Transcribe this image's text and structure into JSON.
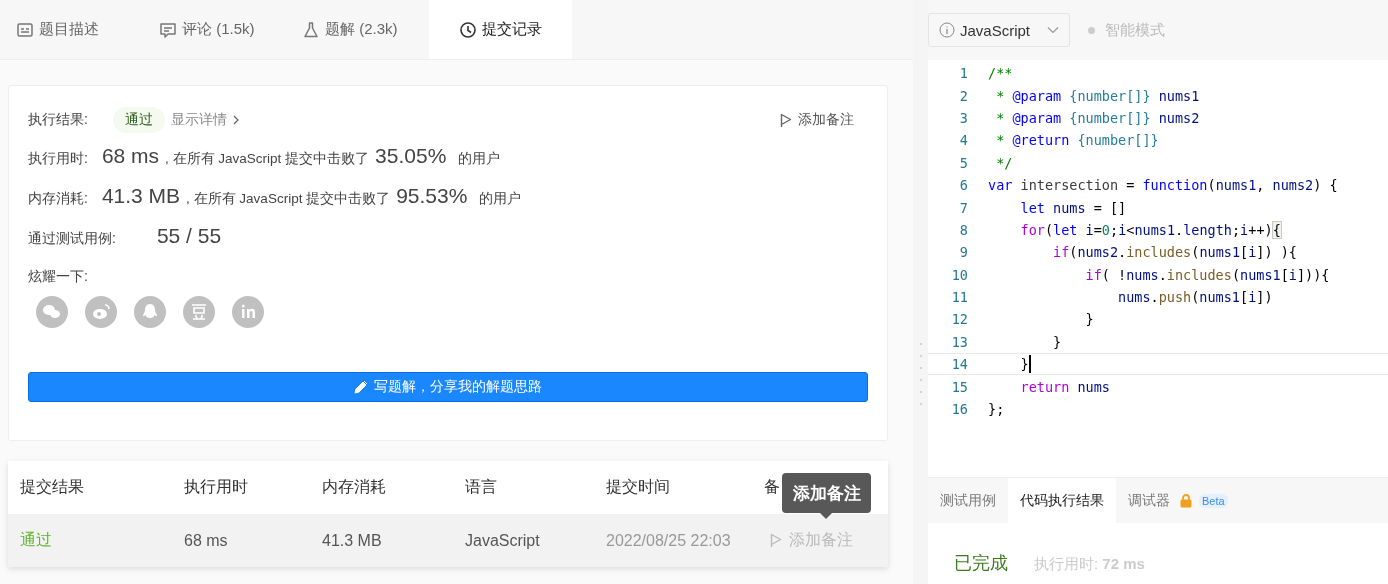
{
  "tabs": [
    {
      "label": "题目描述",
      "selected": false
    },
    {
      "label": "评论 (1.5k)",
      "selected": false
    },
    {
      "label": "题解 (2.3k)",
      "selected": false
    },
    {
      "label": "提交记录",
      "selected": true
    }
  ],
  "result": {
    "status_label": "执行结果:",
    "status": "通过",
    "details_link": "显示详情",
    "note_button": "添加备注",
    "stats": [
      {
        "label": "执行用时:",
        "value": "68 ms",
        "text": ", 在所有 JavaScript 提交中击败了",
        "percent": "35.05%",
        "suffix": "的用户"
      },
      {
        "label": "内存消耗:",
        "value": "41.3 MB",
        "text": ", 在所有 JavaScript 提交中击败了",
        "percent": "95.53%",
        "suffix": "的用户"
      }
    ],
    "tests_label": "通过测试用例:",
    "tests_value": "55 / 55",
    "share_label": "炫耀一下:",
    "share_buttons": [
      {
        "kind": "wechat"
      },
      {
        "kind": "weibo"
      },
      {
        "kind": "qq"
      },
      {
        "kind": "douban"
      },
      {
        "kind": "linkedin"
      }
    ],
    "write_button": "写题解，分享我的解题思路"
  },
  "submissions": {
    "columns": [
      "提交结果",
      "执行用时",
      "内存消耗",
      "语言",
      "提交时间",
      "备"
    ],
    "rows": [
      {
        "status": "通过",
        "runtime": "68 ms",
        "memory": "41.3 MB",
        "language": "JavaScript",
        "time": "2022/08/25 22:03",
        "note": "添加备注",
        "hovered": true
      }
    ],
    "tooltip": "添加备注"
  },
  "editor": {
    "language": "JavaScript",
    "smart_mode": "智能模式",
    "lines": [
      {
        "number": "1",
        "current": false,
        "tokens": [
          {
            "kind": "comment",
            "text": "/**"
          }
        ]
      },
      {
        "number": "2",
        "current": false,
        "tokens": [
          {
            "kind": "comment",
            "text": " * "
          },
          {
            "kind": "tag",
            "text": "@param"
          },
          {
            "kind": "type",
            "text": " {number[]}"
          },
          {
            "kind": "variable",
            "text": " nums1"
          }
        ]
      },
      {
        "number": "3",
        "current": false,
        "tokens": [
          {
            "kind": "comment",
            "text": " * "
          },
          {
            "kind": "tag",
            "text": "@param"
          },
          {
            "kind": "type",
            "text": " {number[]}"
          },
          {
            "kind": "variable",
            "text": " nums2"
          }
        ]
      },
      {
        "number": "4",
        "current": false,
        "tokens": [
          {
            "kind": "comment",
            "text": " * "
          },
          {
            "kind": "tag",
            "text": "@return"
          },
          {
            "kind": "type",
            "text": " {number[]}"
          }
        ]
      },
      {
        "number": "5",
        "current": false,
        "tokens": [
          {
            "kind": "comment",
            "text": " */"
          }
        ]
      },
      {
        "number": "6",
        "current": false,
        "tokens": [
          {
            "kind": "keyword",
            "text": "var"
          },
          {
            "kind": "name",
            "text": " intersection"
          },
          {
            "kind": "plain",
            "text": " = "
          },
          {
            "kind": "keyword",
            "text": "function"
          },
          {
            "kind": "plain",
            "text": "("
          },
          {
            "kind": "variable",
            "text": "nums1"
          },
          {
            "kind": "plain",
            "text": ", "
          },
          {
            "kind": "variable",
            "text": "nums2"
          },
          {
            "kind": "plain",
            "text": ") {"
          }
        ]
      },
      {
        "number": "7",
        "current": false,
        "tokens": [
          {
            "kind": "keyword",
            "text": "    let"
          },
          {
            "kind": "variable",
            "text": " nums"
          },
          {
            "kind": "plain",
            "text": " = []"
          }
        ]
      },
      {
        "number": "8",
        "current": false,
        "tokens": [
          {
            "kind": "control",
            "text": "    for"
          },
          {
            "kind": "plain",
            "text": "("
          },
          {
            "kind": "keyword",
            "text": "let"
          },
          {
            "kind": "variable",
            "text": " i"
          },
          {
            "kind": "plain",
            "text": "="
          },
          {
            "kind": "number",
            "text": "0"
          },
          {
            "kind": "plain",
            "text": ";"
          },
          {
            "kind": "variable",
            "text": "i"
          },
          {
            "kind": "plain",
            "text": "<"
          },
          {
            "kind": "variable",
            "text": "nums1"
          },
          {
            "kind": "plain",
            "text": "."
          },
          {
            "kind": "variable",
            "text": "length"
          },
          {
            "kind": "plain",
            "text": ";"
          },
          {
            "kind": "variable",
            "text": "i"
          },
          {
            "kind": "plain",
            "text": "++)"
          },
          {
            "kind": "match",
            "text": "{"
          }
        ]
      },
      {
        "number": "9",
        "current": false,
        "tokens": [
          {
            "kind": "control",
            "text": "        if"
          },
          {
            "kind": "plain",
            "text": "("
          },
          {
            "kind": "variable",
            "text": "nums2"
          },
          {
            "kind": "plain",
            "text": "."
          },
          {
            "kind": "function",
            "text": "includes"
          },
          {
            "kind": "plain",
            "text": "("
          },
          {
            "kind": "variable",
            "text": "nums1"
          },
          {
            "kind": "plain",
            "text": "["
          },
          {
            "kind": "variable",
            "text": "i"
          },
          {
            "kind": "plain",
            "text": "]) ){"
          }
        ]
      },
      {
        "number": "10",
        "current": false,
        "tokens": [
          {
            "kind": "control",
            "text": "            if"
          },
          {
            "kind": "plain",
            "text": "( !"
          },
          {
            "kind": "variable",
            "text": "nums"
          },
          {
            "kind": "plain",
            "text": "."
          },
          {
            "kind": "function",
            "text": "includes"
          },
          {
            "kind": "plain",
            "text": "("
          },
          {
            "kind": "variable",
            "text": "nums1"
          },
          {
            "kind": "plain",
            "text": "["
          },
          {
            "kind": "variable",
            "text": "i"
          },
          {
            "kind": "plain",
            "text": "])){"
          }
        ]
      },
      {
        "number": "11",
        "current": false,
        "tokens": [
          {
            "kind": "variable",
            "text": "                nums"
          },
          {
            "kind": "plain",
            "text": "."
          },
          {
            "kind": "function",
            "text": "push"
          },
          {
            "kind": "plain",
            "text": "("
          },
          {
            "kind": "variable",
            "text": "nums1"
          },
          {
            "kind": "plain",
            "text": "["
          },
          {
            "kind": "variable",
            "text": "i"
          },
          {
            "kind": "plain",
            "text": "])"
          }
        ]
      },
      {
        "number": "12",
        "current": false,
        "tokens": [
          {
            "kind": "plain",
            "text": "            }"
          }
        ]
      },
      {
        "number": "13",
        "current": false,
        "tokens": [
          {
            "kind": "plain",
            "text": "        }"
          }
        ]
      },
      {
        "number": "14",
        "current": true,
        "tokens": [
          {
            "kind": "plain",
            "text": "    }"
          }
        ]
      },
      {
        "number": "15",
        "current": false,
        "tokens": [
          {
            "kind": "control",
            "text": "    return"
          },
          {
            "kind": "variable",
            "text": " nums"
          }
        ]
      },
      {
        "number": "16",
        "current": false,
        "tokens": [
          {
            "kind": "plain",
            "text": "};"
          }
        ]
      }
    ]
  },
  "console": {
    "tabs": [
      {
        "label": "测试用例",
        "selected": false,
        "locked": false
      },
      {
        "label": "代码执行结果",
        "selected": true,
        "locked": false
      },
      {
        "label": "调试器",
        "selected": false,
        "locked": true,
        "badge": "Beta"
      }
    ],
    "status": "已完成",
    "runtime": "执行用时: **72 ms**"
  }
}
